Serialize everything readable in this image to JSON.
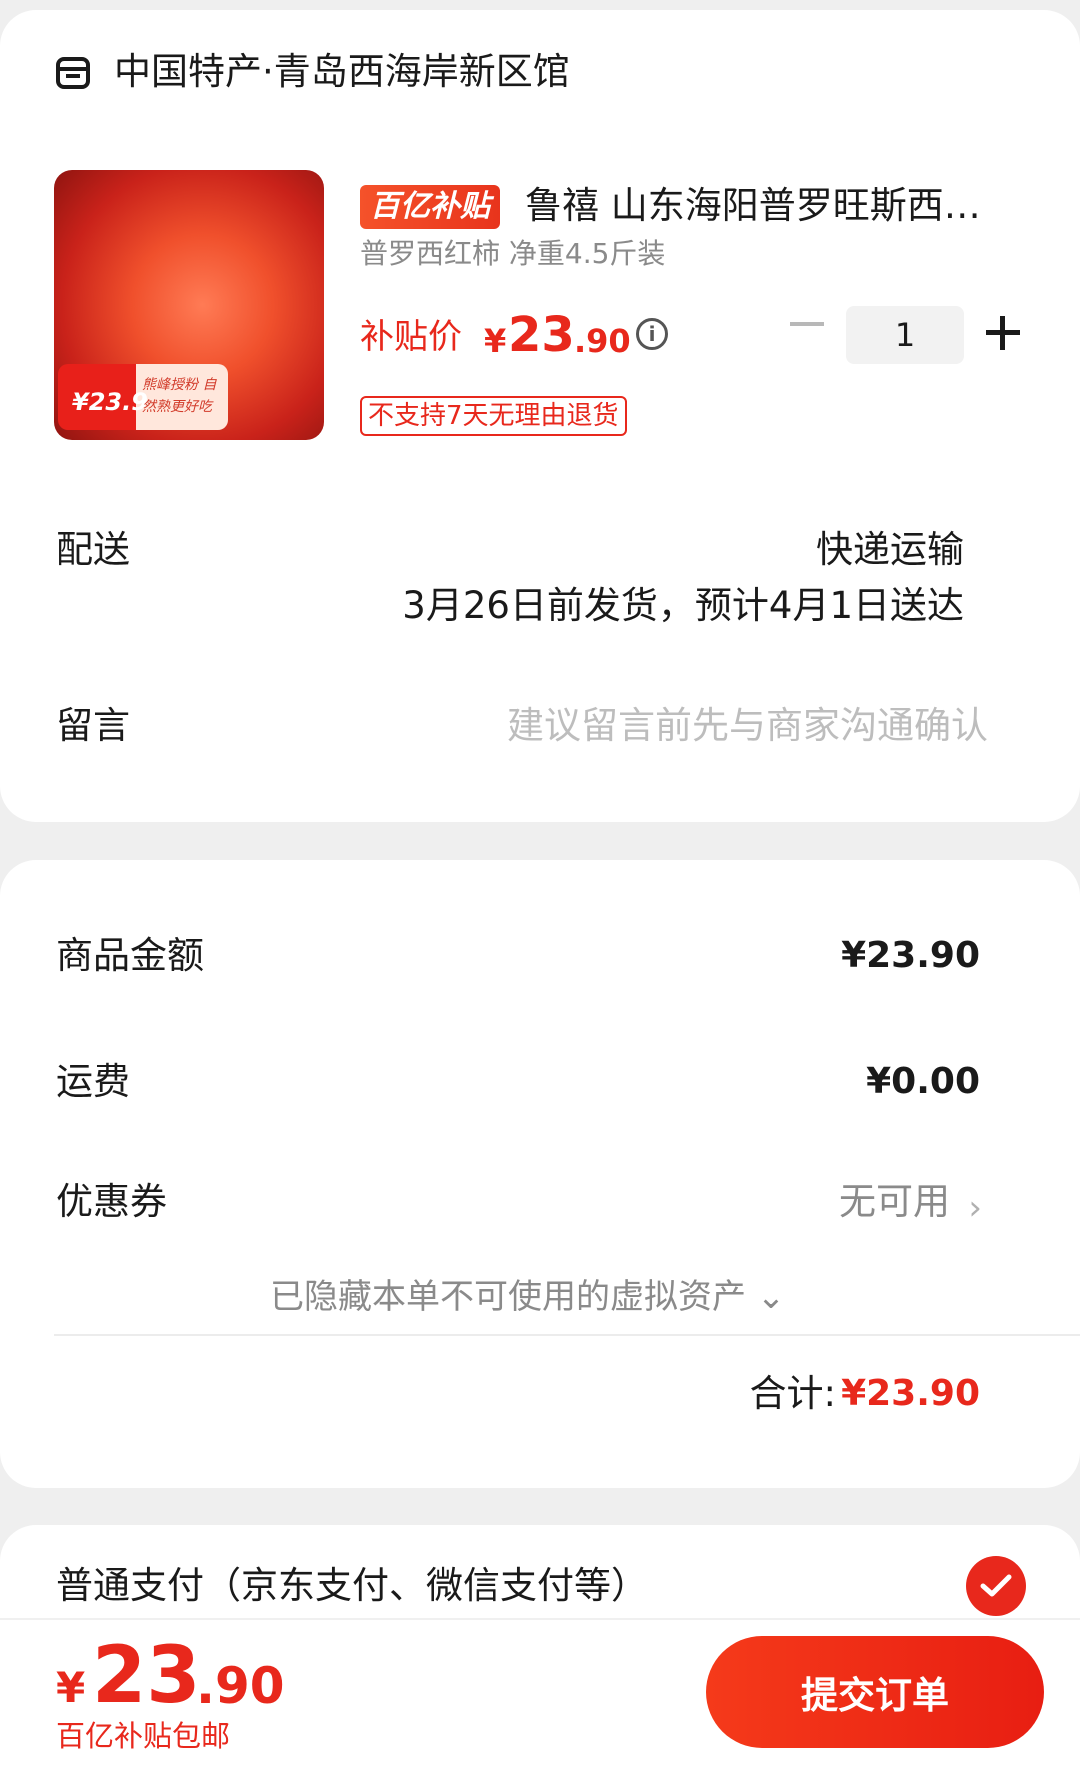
{
  "shop": {
    "name": "中国特产·青岛西海岸新区馆",
    "icon": "store-icon"
  },
  "product": {
    "badge": "百亿补贴",
    "title": "鲁禧 山东海阳普罗旺斯西…",
    "spec": "普罗西红柿 净重4.5斤装",
    "price_label": "补贴价",
    "price_symbol": "¥",
    "price_integer": "23",
    "price_decimal": ".90",
    "quantity": "1",
    "return_policy": "不支持7天无理由退货",
    "image_tag_price": "¥23.9",
    "image_tag_text": "熊峰授粉 自然熟更好吃"
  },
  "delivery": {
    "label": "配送",
    "method": "快递运输",
    "date": "3月26日前发货，预计4月1日送达"
  },
  "message": {
    "label": "留言",
    "placeholder": "建议留言前先与商家沟通确认"
  },
  "summary": {
    "goods_label": "商品金额",
    "goods_value": "¥23.90",
    "shipping_label": "运费",
    "shipping_value": "¥0.00",
    "coupon_label": "优惠券",
    "coupon_value": "无可用",
    "hidden_assets": "已隐藏本单不可使用的虚拟资产 ⌄",
    "total_label": "合计:",
    "total_value": "¥23.90"
  },
  "payment": {
    "method": "普通支付（京东支付、微信支付等）",
    "selected": true
  },
  "footer": {
    "price_symbol": "¥",
    "price_integer": "23",
    "price_decimal": ".90",
    "note": "百亿补贴包邮",
    "submit": "提交订单"
  },
  "colors": {
    "accent": "#e8281c",
    "background": "#efefef",
    "card": "#ffffff"
  }
}
